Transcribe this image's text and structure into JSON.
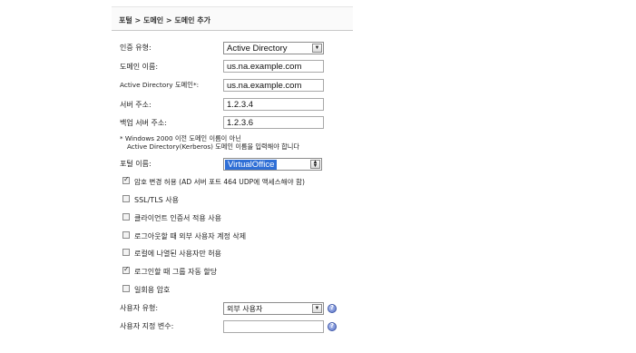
{
  "breadcrumb": "포털 > 도메인 > 도메인 추가",
  "form": {
    "auth_type": {
      "label": "인증 유형:",
      "value": "Active Directory"
    },
    "domain_name": {
      "label": "도메인 이름:",
      "value": "us.na.example.com"
    },
    "ad_domain": {
      "label": "Active Directory 도메인*:",
      "value": "us.na.example.com"
    },
    "server_address": {
      "label": "서버 주소:",
      "value": "1.2.3.4"
    },
    "backup_server": {
      "label": "백업 서버 주소:",
      "value": "1.2.3.6"
    },
    "note_line1": "* Windows 2000 이전 도메인 이름이 아닌",
    "note_line2": "Active Directory(Kerberos) 도메인 이름을 입력해야 합니다",
    "portal_name": {
      "label": "포털 이름:",
      "value": "VirtualOffice"
    },
    "checkboxes": [
      {
        "label": "암호 변경 허용 (AD 서버 포트 464 UDP에 액세스해야 함)",
        "checked": true
      },
      {
        "label": "SSL/TLS 사용",
        "checked": false
      },
      {
        "label": "클라이언트 인증서 적용 사용",
        "checked": false
      },
      {
        "label": "로그아웃할 때 외부 사용자 계정 삭제",
        "checked": false
      },
      {
        "label": "로컬에 나열된 사용자만 허용",
        "checked": false
      },
      {
        "label": "로그인할 때 그룹 자동 할당",
        "checked": true
      },
      {
        "label": "일회용 암호",
        "checked": false
      }
    ],
    "user_type": {
      "label": "사용자 유형:",
      "value": "외부 사용자"
    },
    "user_count": {
      "label": "사용자 지정 변수:",
      "value": ""
    }
  },
  "icons": {
    "dropdown": "chevron-down-icon",
    "spinner": "up-down-spinner-icon",
    "help": "help-icon",
    "check": "checkmark-icon"
  },
  "colors": {
    "selected_highlight": "#2f6fd6",
    "help_icon": "#5a73c8"
  }
}
